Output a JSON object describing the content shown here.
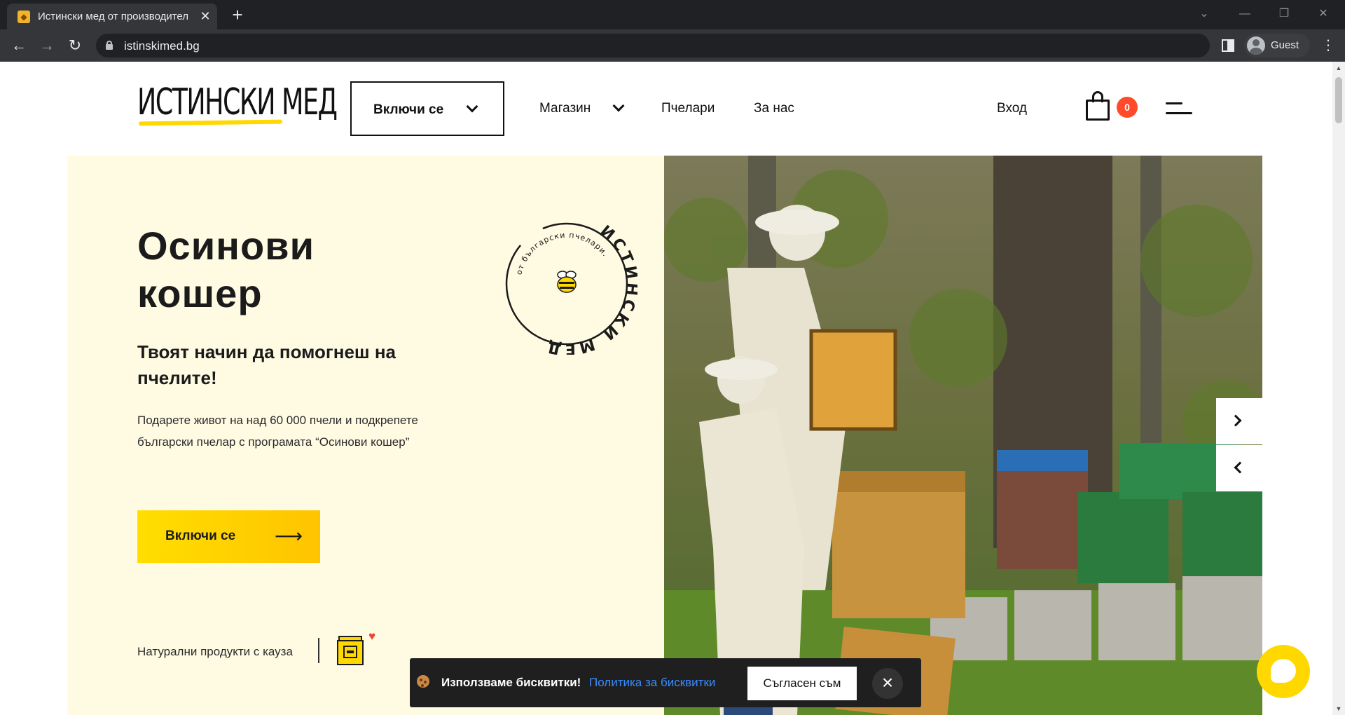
{
  "browser": {
    "tab_title": "Истински мед от производител",
    "url": "istinskimed.bg",
    "profile_label": "Guest"
  },
  "header": {
    "logo_text": "ИСТИНСКИ МЕД",
    "join_dropdown": "Включи се",
    "nav": [
      "Магазин",
      "Пчелари",
      "За нас"
    ],
    "login": "Вход",
    "cart_count": "0"
  },
  "hero": {
    "title_line1": "Осинови",
    "title_line2": "кошер",
    "subtitle": "Твоят начин да помогнеш на пчелите!",
    "body": "Подарете живот на над 60 000 пчели и подкрепете български пчелар с програмата “Осинови кошер”",
    "cta": "Включи се",
    "cause_text": "Натурални продукти с кауза",
    "stamp_outer": "ИСТИНСКИ МЕД",
    "stamp_inner": "от български пчелари."
  },
  "cookie": {
    "text": "Използваме бисквитки!",
    "link": "Политика за бисквитки",
    "accept": "Съгласен съм"
  },
  "colors": {
    "accent_yellow": "#ffd800",
    "hero_bg": "#fffbe3",
    "badge": "#ff4b2b"
  }
}
